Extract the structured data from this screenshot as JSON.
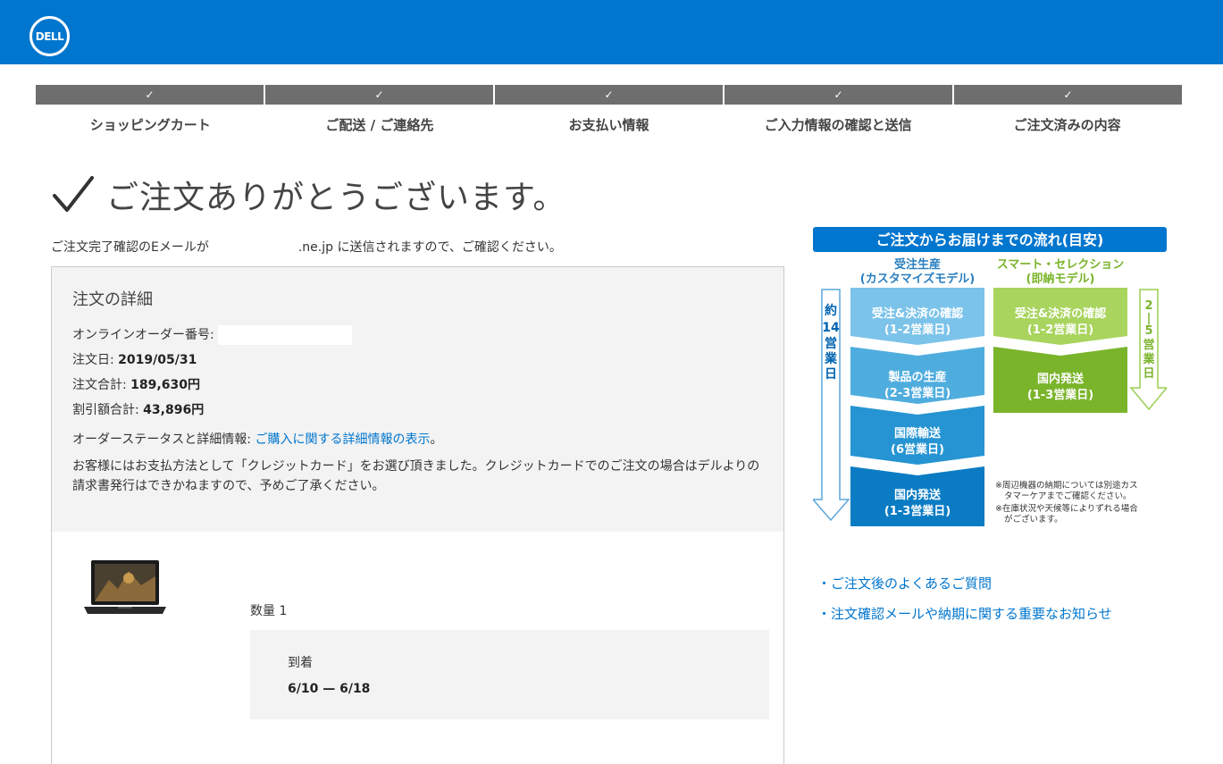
{
  "header": {
    "logo_text": "DELL",
    "brand_color": "#0076CE"
  },
  "stepper": {
    "check": "✓",
    "steps": [
      "ショッピングカート",
      "ご配送 / ご連絡先",
      "お支払い情報",
      "ご入力情報の確認と送信",
      "ご注文済みの内容"
    ]
  },
  "confirmation": {
    "title": "ご注文ありがとうございます。",
    "email_prefix": "ご注文完了確認のEメールが",
    "email_suffix": ".ne.jp に送信されますので、ご確認ください。"
  },
  "order": {
    "title": "注文の詳細",
    "online_order_label": "オンラインオーダー番号:",
    "date_label": "注文日:",
    "date_value": "2019/05/31",
    "total_label": "注文合計:",
    "total_value": "189,630円",
    "discount_label": "割引額合計:",
    "discount_value": "43,896円",
    "status_label": "オーダーステータスと詳細情報:",
    "status_link": "ご購入に関する詳細情報の表示",
    "status_end": "。",
    "payment_note": "お客様にはお支払方法として「クレジットカード」をお選び頂きました。クレジットカードでのご注文の場合はデルよりの請求書発行はできかねますので、予めご了承ください。"
  },
  "item": {
    "quantity": "数量 1",
    "arrival_label": "到着",
    "arrival_dates": "6/10 — 6/18"
  },
  "flow_chart": {
    "title": "ご注文からお届けまでの流れ(目安)",
    "col1_title": "受注生産",
    "col1_subtitle": "(カスタマイズモデル)",
    "col2_title": "スマート・セレクション",
    "col2_subtitle": "(即納モデル)",
    "left_arrow_text": [
      "約",
      "14",
      "営",
      "業",
      "日"
    ],
    "right_arrow_text": [
      "2",
      "|",
      "5",
      "営",
      "業",
      "日"
    ],
    "col1_steps": [
      {
        "name": "受注&決済の確認",
        "days": "(1-2営業日)"
      },
      {
        "name": "製品の生産",
        "days": "(2-3営業日)"
      },
      {
        "name": "国際輸送",
        "days": "(6営業日)"
      },
      {
        "name": "国内発送",
        "days": "(1-3営業日)"
      }
    ],
    "col2_steps": [
      {
        "name": "受注&決済の確認",
        "days": "(1-2営業日)"
      },
      {
        "name": "国内発送",
        "days": "(1-3営業日)"
      }
    ],
    "notes": [
      "※周辺機器の納期については別途カス",
      "タマーケアまでご確認ください。",
      "※在庫状況や天候等によりずれる場合",
      "がございます。"
    ]
  },
  "links": {
    "faq": "・ご注文後のよくあるご質問",
    "notice": "・注文確認メールや納期に関する重要なお知らせ"
  }
}
